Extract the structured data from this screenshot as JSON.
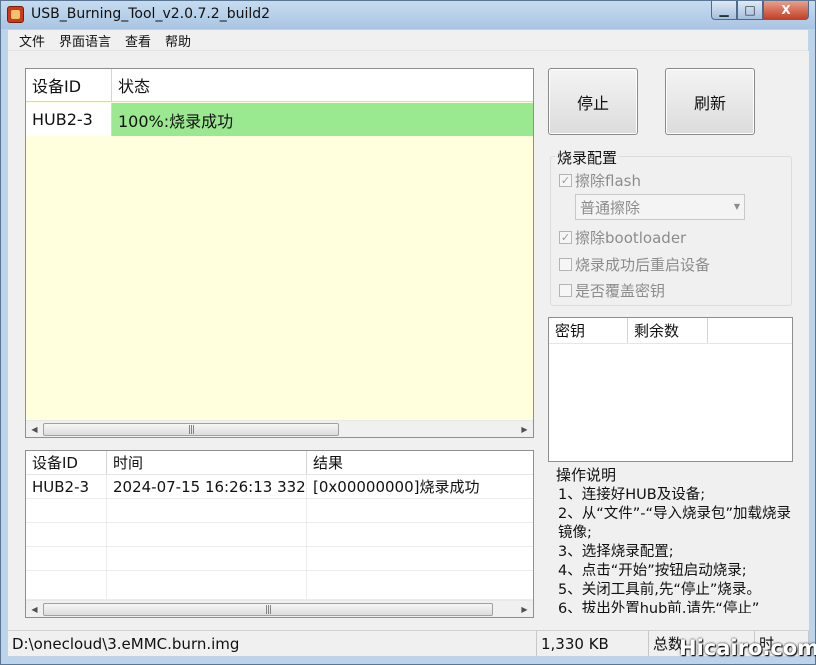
{
  "window": {
    "title": "USB_Burning_Tool_v2.0.7.2_build2",
    "controls": {
      "minimize": "▁",
      "maximize": "□",
      "close": "X"
    }
  },
  "menu": [
    "文件",
    "界面语言",
    "查看",
    "帮助"
  ],
  "device_list": {
    "headers": [
      "设备ID",
      "状态"
    ],
    "rows": [
      {
        "id": "HUB2-3",
        "status": "100%:烧录成功"
      }
    ],
    "status_color": "#9ae88f",
    "background": "#ffffdd"
  },
  "log": {
    "headers": [
      "设备ID",
      "时间",
      "结果"
    ],
    "rows": [
      {
        "id": "HUB2-3",
        "time": "2024-07-15 16:26:13 332",
        "result": "[0x00000000]烧录成功"
      }
    ]
  },
  "buttons": {
    "stop": "停止",
    "refresh": "刷新"
  },
  "burn_config": {
    "title": "烧录配置",
    "erase_flash": {
      "label": "擦除flash",
      "checked": true,
      "enabled": false
    },
    "erase_mode": {
      "value": "普通擦除"
    },
    "erase_bootloader": {
      "label": "擦除bootloader",
      "checked": true,
      "enabled": false
    },
    "reboot_after": {
      "label": "烧录成功后重启设备",
      "checked": false,
      "enabled": false
    },
    "overwrite_key": {
      "label": "是否覆盖密钥",
      "checked": false,
      "enabled": false
    }
  },
  "key_table": {
    "headers": [
      "密钥",
      "剩余数"
    ]
  },
  "instructions": {
    "title": "操作说明",
    "lines": [
      "1、连接好HUB及设备;",
      "2、从“文件”-“导入烧录包”加载烧录镜像;",
      "3、选择烧录配置;",
      "4、点击“开始”按钮启动烧录;",
      "5、关闭工具前,先“停止”烧录。",
      "6、拔出外置hub前,请先“停止”"
    ]
  },
  "statusbar": {
    "path": "D:\\onecloud\\3.eMMC.burn.img",
    "size": "1,330 KB",
    "total": "总数",
    "time": "时"
  },
  "watermark": "Hicairo.com"
}
